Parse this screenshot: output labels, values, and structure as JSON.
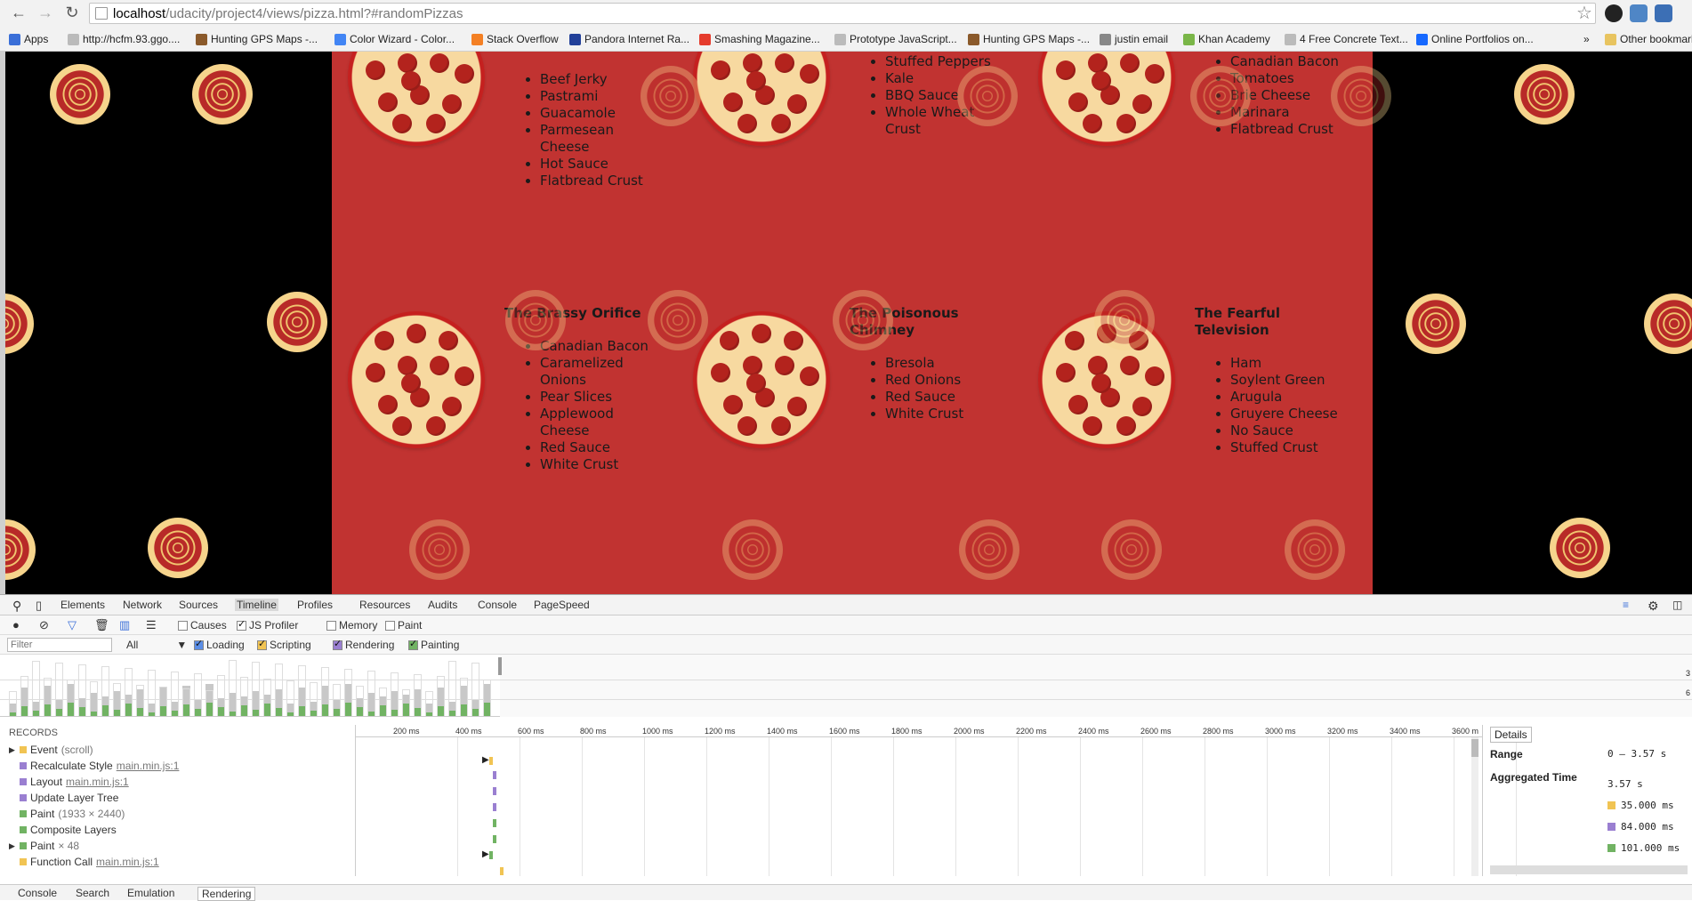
{
  "browser": {
    "url_host": "localhost",
    "url_rest": "/udacity/project4/views/pizza.html?#randomPizzas",
    "bookmarks": [
      {
        "label": "Apps",
        "color": "#3a6fd8"
      },
      {
        "label": "http://hcfm.93.ggo....",
        "color": "#bbbbbb"
      },
      {
        "label": "Hunting GPS Maps -...",
        "color": "#8b5a2b"
      },
      {
        "label": "Color Wizard - Color...",
        "color": "#4285f4"
      },
      {
        "label": "Stack Overflow",
        "color": "#f48024"
      },
      {
        "label": "Pandora Internet Ra...",
        "color": "#224099"
      },
      {
        "label": "Smashing Magazine...",
        "color": "#e53b2c"
      },
      {
        "label": "Prototype JavaScript...",
        "color": "#bbbbbb"
      },
      {
        "label": "Hunting GPS Maps -...",
        "color": "#8b5a2b"
      },
      {
        "label": "justin email",
        "color": "#888888"
      },
      {
        "label": "Khan Academy",
        "color": "#7ab648"
      },
      {
        "label": "4 Free Concrete Text...",
        "color": "#bbbbbb"
      },
      {
        "label": "Online Portfolios on...",
        "color": "#1769ff"
      }
    ],
    "more": "»",
    "other_bookmarks": "Other bookmarks"
  },
  "pizzas": [
    {
      "name": "",
      "toppings": [
        "Beef Jerky",
        "Pastrami",
        "Guacamole",
        "Parmesean Cheese",
        "Hot Sauce",
        "Flatbread Crust"
      ]
    },
    {
      "name": "",
      "toppings": [
        "Stuffed Peppers",
        "Kale",
        "BBQ Sauce",
        "Whole Wheat Crust"
      ]
    },
    {
      "name": "",
      "toppings": [
        "Canadian Bacon",
        "Tomatoes",
        "Brie Cheese",
        "Marinara",
        "Flatbread Crust"
      ]
    },
    {
      "name": "The Brassy Orifice",
      "toppings": [
        "Canadian Bacon",
        "Caramelized Onions",
        "Pear Slices",
        "Applewood Cheese",
        "Red Sauce",
        "White Crust"
      ]
    },
    {
      "name": "The Poisonous Chimney",
      "toppings": [
        "Bresola",
        "Red Onions",
        "Red Sauce",
        "White Crust"
      ]
    },
    {
      "name": "The Fearful Television",
      "toppings": [
        "Ham",
        "Soylent Green",
        "Arugula",
        "Gruyere Cheese",
        "No Sauce",
        "Stuffed Crust"
      ]
    }
  ],
  "devtools": {
    "tabs": [
      "Elements",
      "Network",
      "Sources",
      "Timeline",
      "Profiles",
      "Resources",
      "Audits",
      "Console",
      "PageSpeed"
    ],
    "active_tab": "Timeline",
    "toolbar_checks": [
      {
        "label": "Causes",
        "checked": false
      },
      {
        "label": "JS Profiler",
        "checked": true
      },
      {
        "label": "Memory",
        "checked": false
      },
      {
        "label": "Paint",
        "checked": false
      }
    ],
    "filter_placeholder": "Filter",
    "filter_select": "All",
    "category_checks": [
      {
        "label": "Loading",
        "checked": true,
        "color": "#5b8ee6"
      },
      {
        "label": "Scripting",
        "checked": true,
        "color": "#f1c453"
      },
      {
        "label": "Rendering",
        "checked": true,
        "color": "#9a7fd1"
      },
      {
        "label": "Painting",
        "checked": true,
        "color": "#71b363"
      }
    ],
    "overview_right_labels": [
      "3",
      "6"
    ],
    "ruler_ticks": [
      "200 ms",
      "400 ms",
      "600 ms",
      "800 ms",
      "1000 ms",
      "1200 ms",
      "1400 ms",
      "1600 ms",
      "1800 ms",
      "2000 ms",
      "2200 ms",
      "2400 ms",
      "2600 ms",
      "2800 ms",
      "3000 ms",
      "3200 ms",
      "3400 ms",
      "3600 m"
    ],
    "records_header": "RECORDS",
    "records": [
      {
        "expander": "▶",
        "label": "Event",
        "extra": "(scroll)",
        "link": "",
        "color": "#f1c453"
      },
      {
        "expander": "",
        "label": "Recalculate Style",
        "extra": "",
        "link": "main.min.js:1",
        "color": "#9a7fd1"
      },
      {
        "expander": "",
        "label": "Layout",
        "extra": "",
        "link": "main.min.js:1",
        "color": "#9a7fd1"
      },
      {
        "expander": "",
        "label": "Update Layer Tree",
        "extra": "",
        "link": "",
        "color": "#9a7fd1"
      },
      {
        "expander": "",
        "label": "Paint",
        "extra": "(1933 × 2440)",
        "link": "",
        "color": "#71b363"
      },
      {
        "expander": "",
        "label": "Composite Layers",
        "extra": "",
        "link": "",
        "color": "#71b363"
      },
      {
        "expander": "▶",
        "label": "Paint",
        "extra": "× 48",
        "link": "",
        "color": "#71b363"
      },
      {
        "expander": "",
        "label": "Function Call",
        "extra": "",
        "link": "main.min.js:1",
        "color": "#f1c453"
      }
    ],
    "details_tab": "Details",
    "details": {
      "range_label": "Range",
      "range_value": "0 – 3.57 s",
      "agg_label": "Aggregated Time",
      "agg_value": "3.57 s",
      "items": [
        {
          "value": "35.000 ms",
          "color": "#f1c453"
        },
        {
          "value": "84.000 ms",
          "color": "#9a7fd1"
        },
        {
          "value": "101.000 ms",
          "color": "#71b363"
        }
      ]
    },
    "bottom_tabs": [
      "Console",
      "Search",
      "Emulation",
      "Rendering"
    ],
    "bottom_active": "Rendering"
  }
}
